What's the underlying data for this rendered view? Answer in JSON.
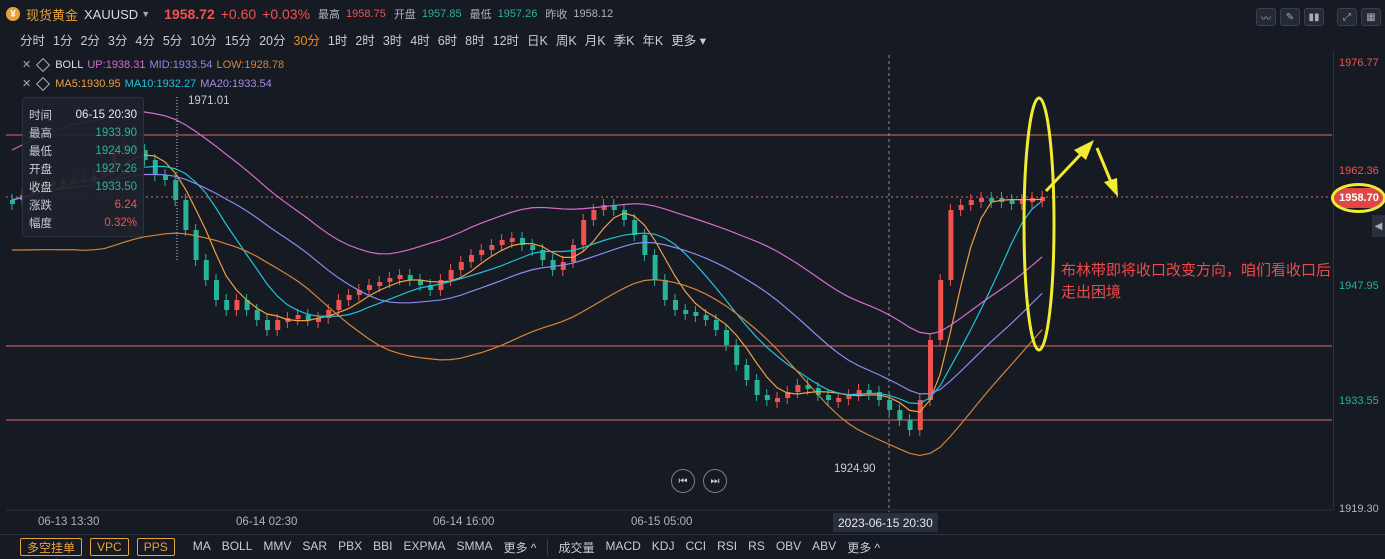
{
  "header": {
    "symbol_name": "现货黄金",
    "symbol_code": "XAUUSD",
    "price": "1958.72",
    "change": "+0.60",
    "change_pct": "+0.03%",
    "high_label": "最高",
    "high": "1958.75",
    "open_label": "开盘",
    "open": "1957.85",
    "low_label": "最低",
    "low": "1957.26",
    "prev_label": "昨收",
    "prev": "1958.12"
  },
  "periods": [
    "分时",
    "1分",
    "2分",
    "3分",
    "4分",
    "5分",
    "10分",
    "15分",
    "20分",
    "30分",
    "1时",
    "2时",
    "3时",
    "4时",
    "6时",
    "8时",
    "12时",
    "日K",
    "周K",
    "月K",
    "季K",
    "年K",
    "更多"
  ],
  "active_period": "30分",
  "indicators": {
    "boll_name": "BOLL",
    "boll_up": "UP:1938.31",
    "boll_mid": "MID:1933.54",
    "boll_low": "LOW:1928.78",
    "ma5": "MA5:1930.95",
    "ma10": "MA10:1932.27",
    "ma20": "MA20:1933.54"
  },
  "tooltip": {
    "time_label": "时间",
    "time": "06-15 20:30",
    "high_label": "最高",
    "high": "1933.90",
    "low_label": "最低",
    "low": "1924.90",
    "open_label": "开盘",
    "open": "1927.26",
    "close_label": "收盘",
    "close": "1933.50",
    "chg_label": "涨跌",
    "chg": "6.24",
    "amp_label": "幅度",
    "amp": "0.32%"
  },
  "price_axis": [
    "1976.77",
    "1962.36",
    "1947.95",
    "1933.55",
    "1919.30"
  ],
  "current_price_badge": "1958.70",
  "time_axis": [
    "06-13 13:30",
    "06-14 02:30",
    "06-14 16:00",
    "06-15 05:00"
  ],
  "crosshair_time": "2023-06-15 20:30",
  "high_marker": "1971.01",
  "low_marker": "1924.90",
  "annotation": "布林带即将收口改变方向，咱们看收口后走出困境",
  "bottom": {
    "buttons": [
      "多空挂单",
      "VPC",
      "PPS"
    ],
    "main_indicators": [
      "MA",
      "BOLL",
      "MMV",
      "SAR",
      "PBX",
      "BBI",
      "EXPMA",
      "SMMA",
      "更多 ^"
    ],
    "sub_indicators": [
      "成交量",
      "MACD",
      "KDJ",
      "CCI",
      "RSI",
      "RS",
      "OBV",
      "ABV",
      "更多 ^"
    ]
  },
  "colors": {
    "up": "#ef5350",
    "down": "#26b39a",
    "boll_up": "#d96bd0",
    "boll_mid": "#8a8af0",
    "boll_low": "#d6843a",
    "ma5": "#f0a043",
    "ma10": "#22c1d6",
    "ma20": "#a78be6",
    "annotation": "#f1ec31"
  }
}
